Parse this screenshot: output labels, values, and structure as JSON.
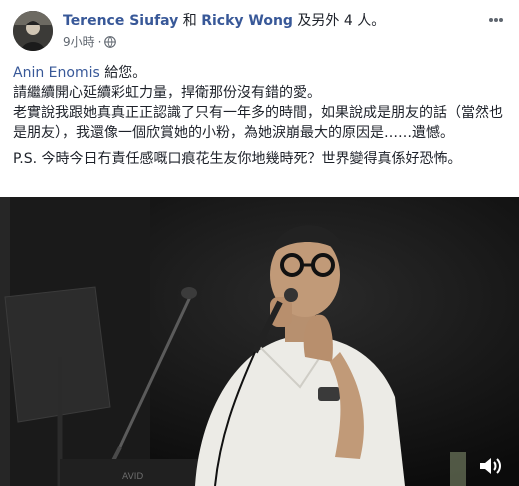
{
  "post": {
    "author": "Terence Siufay",
    "connector_and": "和",
    "co_author": "Ricky Wong",
    "connector_others": "及另外",
    "others": "4 人。",
    "time": "9小時",
    "privacy_icon": "globe-icon",
    "more_icon": "more-options-icon",
    "body": {
      "recipient_name": "Anin Enomis",
      "recipient_suffix": "給您。",
      "line1": "請繼續開心延續彩虹力量，捍衛那份沒有錯的愛。",
      "line2": "老實說我跟她真真正正認識了只有一年多的時間，如果說成是朋友的話（當然也是朋友），我還像一個欣賞她的小粉，為她淚崩最大的原因是……遺憾。",
      "line3": "P.S. 今時今日冇責任感嘅口痕花生友你地幾時死？世界變得真係好恐怖。"
    },
    "media": {
      "volume_icon": "speaker-volume-icon",
      "colors": {
        "background": "#121212",
        "shirt": "#ecebe6"
      }
    }
  },
  "colors": {
    "link": "#385898",
    "meta": "#606770",
    "text": "#1d2129"
  }
}
